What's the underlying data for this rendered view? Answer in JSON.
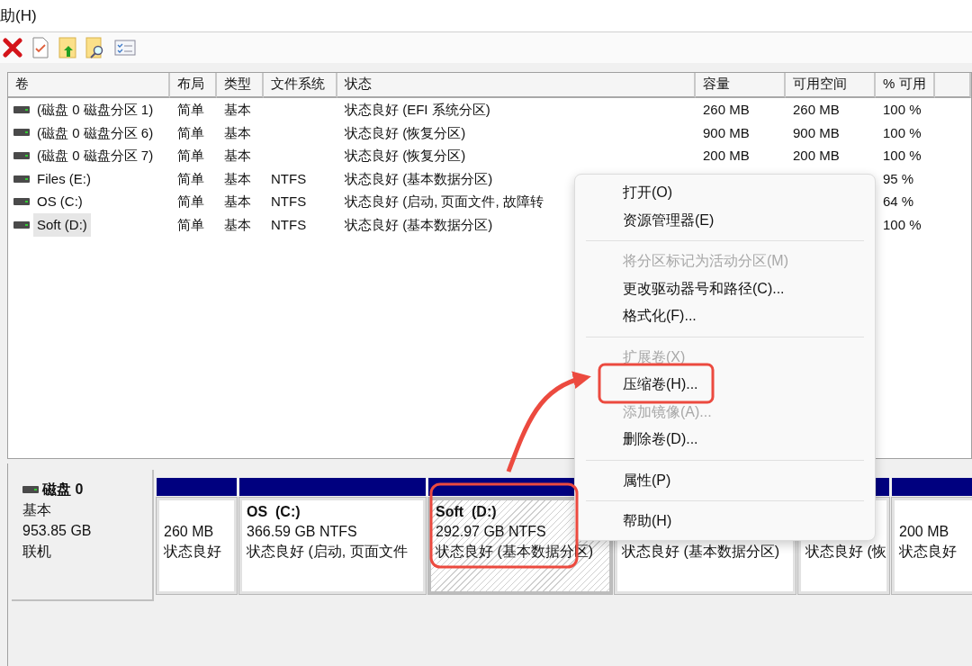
{
  "menubar": {
    "items": [
      "助(H)"
    ]
  },
  "table": {
    "columns": [
      "卷",
      "布局",
      "类型",
      "文件系统",
      "状态",
      "容量",
      "可用空间",
      "% 可用"
    ],
    "rows": [
      {
        "volume": "(磁盘 0 磁盘分区 1)",
        "layout": "简单",
        "type": "基本",
        "filesystem": "",
        "status": "状态良好 (EFI 系统分区)",
        "capacity": "260 MB",
        "free": "260 MB",
        "percent_free": "100 %",
        "selected": false
      },
      {
        "volume": "(磁盘 0 磁盘分区 6)",
        "layout": "简单",
        "type": "基本",
        "filesystem": "",
        "status": "状态良好 (恢复分区)",
        "capacity": "900 MB",
        "free": "900 MB",
        "percent_free": "100 %",
        "selected": false
      },
      {
        "volume": "(磁盘 0 磁盘分区 7)",
        "layout": "简单",
        "type": "基本",
        "filesystem": "",
        "status": "状态良好 (恢复分区)",
        "capacity": "200 MB",
        "free": "200 MB",
        "percent_free": "100 %",
        "selected": false
      },
      {
        "volume": "Files (E:)",
        "layout": "简单",
        "type": "基本",
        "filesystem": "NTFS",
        "status": "状态良好 (基本数据分区)",
        "percent_free": "95 %",
        "selected": false
      },
      {
        "volume": "OS (C:)",
        "layout": "简单",
        "type": "基本",
        "filesystem": "NTFS",
        "status": "状态良好 (启动, 页面文件, 故障转",
        "percent_free": "64 %",
        "selected": false
      },
      {
        "volume": "Soft (D:)",
        "layout": "简单",
        "type": "基本",
        "filesystem": "NTFS",
        "status": "状态良好 (基本数据分区)",
        "percent_free": "100 %",
        "selected": true
      }
    ]
  },
  "disk": {
    "name": "磁盘 0",
    "type": "基本",
    "size": "953.85 GB",
    "state": "联机",
    "partitions": [
      {
        "size": "260 MB",
        "status": "状态良好",
        "selected": false
      },
      {
        "title": "OS  (C:)",
        "size": "366.59 GB NTFS",
        "status": "状态良好 (启动, 页面文件",
        "selected": false
      },
      {
        "title": "Soft  (D:)",
        "size": "292.97 GB NTFS",
        "status": "状态良好 (基本数据分区)",
        "selected": true
      },
      {
        "status": "状态良好 (基本数据分区)",
        "selected": false
      },
      {
        "status": "状态良好 (恢",
        "selected": false
      },
      {
        "size": "200 MB",
        "status": "状态良好",
        "selected": false
      }
    ]
  },
  "context_menu": {
    "items": [
      {
        "kind": "item",
        "label": "打开(O)",
        "disabled": false
      },
      {
        "kind": "item",
        "label": "资源管理器(E)",
        "disabled": false
      },
      {
        "kind": "separator"
      },
      {
        "kind": "item",
        "label": "将分区标记为活动分区(M)",
        "disabled": true
      },
      {
        "kind": "item",
        "label": "更改驱动器号和路径(C)...",
        "disabled": false
      },
      {
        "kind": "item",
        "label": "格式化(F)...",
        "disabled": false
      },
      {
        "kind": "separator"
      },
      {
        "kind": "item",
        "label": "扩展卷(X)",
        "disabled": true
      },
      {
        "kind": "item",
        "label": "压缩卷(H)...",
        "disabled": false
      },
      {
        "kind": "item",
        "label": "添加镜像(A)...",
        "disabled": true
      },
      {
        "kind": "item",
        "label": "删除卷(D)...",
        "disabled": false
      },
      {
        "kind": "separator"
      },
      {
        "kind": "item",
        "label": "属性(P)",
        "disabled": false
      },
      {
        "kind": "separator"
      },
      {
        "kind": "item",
        "label": "帮助(H)",
        "disabled": false
      }
    ]
  }
}
